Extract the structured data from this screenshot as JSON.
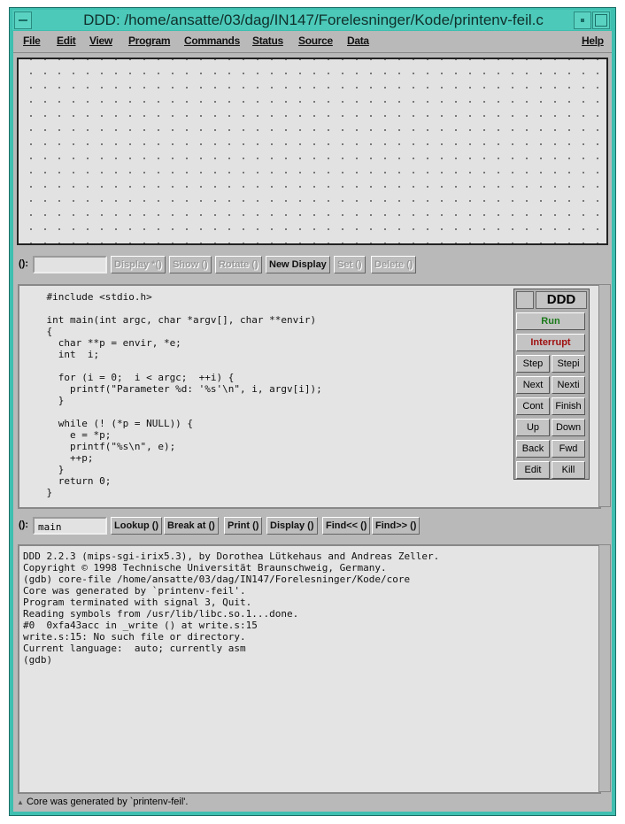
{
  "window": {
    "title": "DDD: /home/ansatte/03/dag/IN147/Forelesninger/Kode/printenv-feil.c"
  },
  "menu": [
    "File",
    "Edit",
    "View",
    "Program",
    "Commands",
    "Status",
    "Source",
    "Data"
  ],
  "help": "Help",
  "data_toolbar": {
    "label": "():",
    "value": "",
    "buttons": [
      {
        "label": "Display *()",
        "enabled": false
      },
      {
        "label": "Show ()",
        "enabled": false
      },
      {
        "label": "Rotate ()",
        "enabled": false
      },
      {
        "label": "New Display",
        "enabled": true
      },
      {
        "label": "Set ()",
        "enabled": false
      },
      {
        "label": "Delete ()",
        "enabled": false
      }
    ]
  },
  "source": {
    "code": "    #include <stdio.h>\n\n    int main(int argc, char *argv[], char **envir)\n    {\n      char **p = envir, *e;\n      int  i;\n\n      for (i = 0;  i < argc;  ++i) {\n        printf(\"Parameter %d: '%s'\\n\", i, argv[i]);\n      }\n\n      while (! (*p = NULL)) {\n        e = *p;\n        printf(\"%s\\n\", e);\n        ++p;\n      }\n      return 0;\n    }"
  },
  "command_tool": {
    "title": "DDD",
    "run": "Run",
    "interrupt": "Interrupt",
    "run_color": "#1a7a1a",
    "interrupt_color": "#a01010",
    "buttons": [
      "Step",
      "Stepi",
      "Next",
      "Nexti",
      "Cont",
      "Finish",
      "Up",
      "Down",
      "Back",
      "Fwd",
      "Edit",
      "Kill"
    ]
  },
  "source_toolbar": {
    "label": "():",
    "value": "main",
    "buttons": [
      "Lookup ()",
      "Break at ()",
      "Print ()",
      "Display ()",
      "Find<< ()",
      "Find>> ()"
    ]
  },
  "console": {
    "text": "DDD 2.2.3 (mips-sgi-irix5.3), by Dorothea Lütkehaus and Andreas Zeller.\nCopyright © 1998 Technische Universität Braunschweig, Germany.\n(gdb) core-file /home/ansatte/03/dag/IN147/Forelesninger/Kode/core\nCore was generated by `printenv-feil'.\nProgram terminated with signal 3, Quit.\nReading symbols from /usr/lib/libc.so.1...done.\n#0  0xfa43acc in _write () at write.s:15\nwrite.s:15: No such file or directory.\nCurrent language:  auto; currently asm\n(gdb) "
  },
  "status": "Core was generated by `printenv-feil'."
}
